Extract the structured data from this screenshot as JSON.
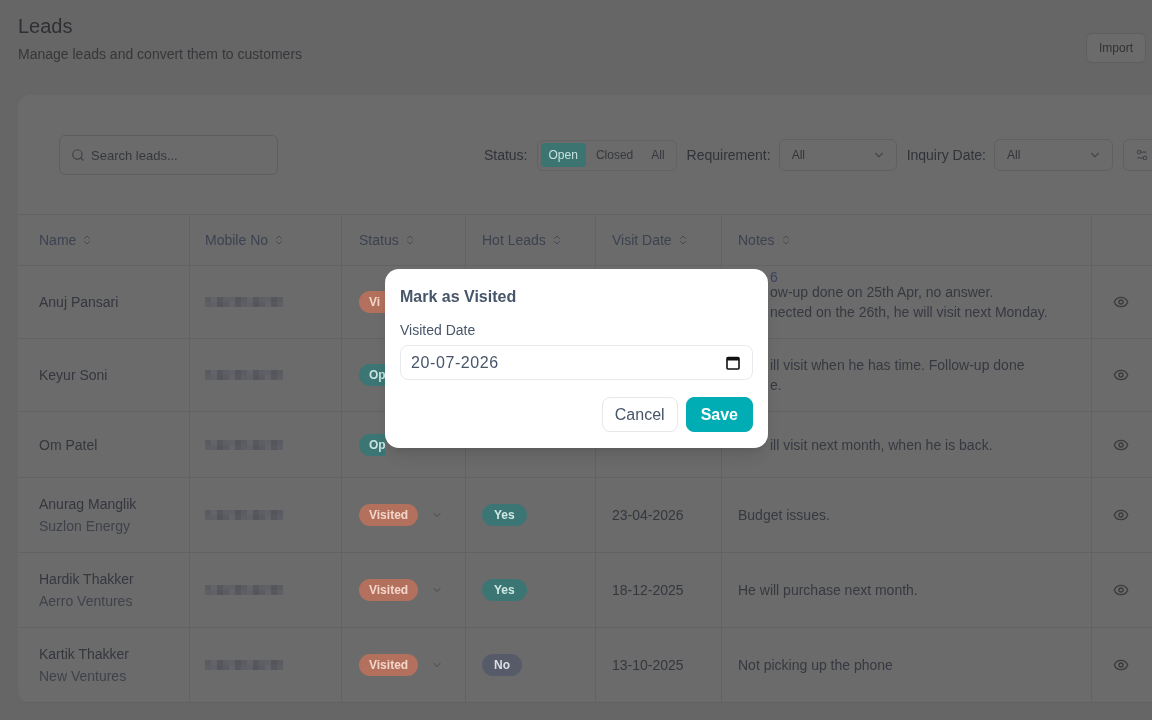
{
  "page": {
    "title": "Leads",
    "subtitle": "Manage leads and convert them to customers",
    "import_button": "Import"
  },
  "filters": {
    "search_placeholder": "Search leads...",
    "status_label": "Status:",
    "status_options": [
      {
        "label": "Open",
        "selected": true
      },
      {
        "label": "Closed",
        "selected": false
      },
      {
        "label": "All",
        "selected": false
      }
    ],
    "requirement": {
      "label": "Requirement:",
      "value": "All"
    },
    "inquiry_date": {
      "label": "Inquiry Date:",
      "value": "All"
    }
  },
  "table": {
    "columns": [
      "Name",
      "Mobile No",
      "Status",
      "Hot Leads",
      "Visit Date",
      "Notes"
    ],
    "rows": [
      {
        "name": "Anuj Pansari",
        "under_dialog": true,
        "mobile_redacted": true,
        "status": {
          "label": "Vi",
          "kind": "visited"
        },
        "notes": [
          "ow-up done on 25th Apr, no answer.",
          "nected on the 26th, he will visit next Monday."
        ]
      },
      {
        "name": "Keyur Soni",
        "under_dialog": true,
        "mobile_redacted": true,
        "status": {
          "label": "Op",
          "kind": "open"
        },
        "notes": [
          "ill visit when he has time. Follow-up done",
          "e."
        ]
      },
      {
        "name": "Om Patel",
        "under_dialog": true,
        "mobile_redacted": true,
        "status": {
          "label": "Op",
          "kind": "open"
        },
        "notes": [
          "ill visit next month, when he is back."
        ]
      },
      {
        "name": "Anurag Manglik",
        "company": "Suzlon Energy",
        "under_dialog": false,
        "mobile_redacted": true,
        "status": {
          "label": "Visited",
          "kind": "visited"
        },
        "hot_lead": {
          "label": "Yes",
          "kind": "yes"
        },
        "visit_date": "23-04-2026",
        "notes": [
          "Budget issues."
        ]
      },
      {
        "name": "Hardik Thakker",
        "company": "Aerro Ventures",
        "under_dialog": false,
        "mobile_redacted": true,
        "status": {
          "label": "Visited",
          "kind": "visited"
        },
        "hot_lead": {
          "label": "Yes",
          "kind": "yes"
        },
        "visit_date": "18-12-2025",
        "notes": [
          "He will purchase next month."
        ]
      },
      {
        "name": "Kartik Thakker",
        "company": "New Ventures",
        "under_dialog": false,
        "mobile_redacted": true,
        "status": {
          "label": "Visited",
          "kind": "visited"
        },
        "hot_lead": {
          "label": "No",
          "kind": "no"
        },
        "visit_date": "13-10-2025",
        "notes": [
          "Not picking up the phone"
        ]
      }
    ]
  },
  "text_fragment": "6",
  "dialog": {
    "title": "Mark as Visited",
    "field_label": "Visited Date",
    "date_value": "20-07-2026",
    "buttons": [
      {
        "label": "Cancel",
        "kind": "secondary"
      },
      {
        "label": "Save",
        "kind": "primary"
      }
    ]
  }
}
